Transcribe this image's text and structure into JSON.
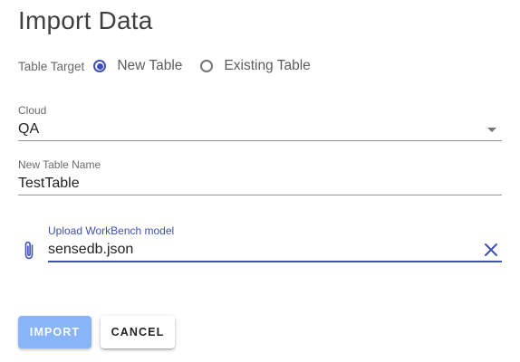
{
  "dialog": {
    "title": "Import Data"
  },
  "table_target": {
    "label": "Table Target",
    "options": [
      {
        "label": "New Table",
        "checked": true
      },
      {
        "label": "Existing Table",
        "checked": false
      }
    ]
  },
  "cloud": {
    "label": "Cloud",
    "value": "QA"
  },
  "new_table_name": {
    "label": "New Table Name",
    "value": "TestTable"
  },
  "upload": {
    "label": "Upload WorkBench model",
    "value": "sensedb.json"
  },
  "buttons": {
    "import_label": "IMPORT",
    "cancel_label": "CANCEL"
  },
  "colors": {
    "accent": "#3f51b5",
    "import_button_bg": "#8ab4f8"
  },
  "icons": {
    "attach": "paperclip-icon",
    "clear": "close-icon",
    "select": "dropdown-arrow-icon"
  }
}
